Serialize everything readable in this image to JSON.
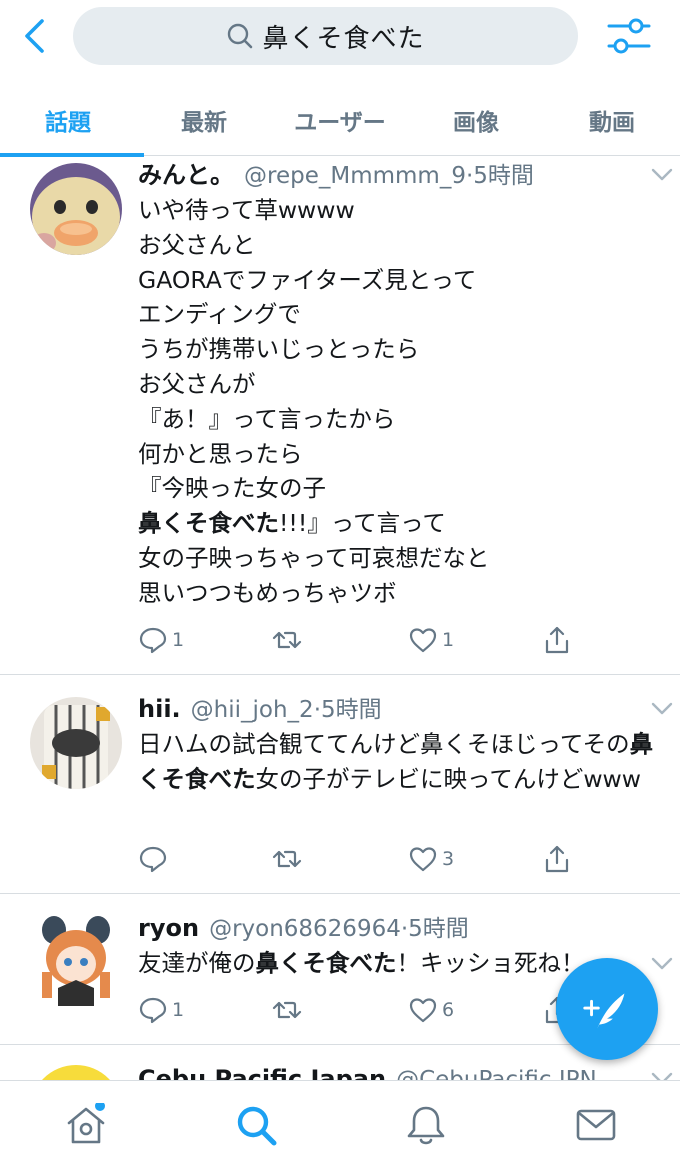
{
  "search": {
    "query": "鼻くそ食べた"
  },
  "tabs": [
    {
      "label": "話題",
      "active": true
    },
    {
      "label": "最新",
      "active": false
    },
    {
      "label": "ユーザー",
      "active": false
    },
    {
      "label": "画像",
      "active": false
    },
    {
      "label": "動画",
      "active": false
    }
  ],
  "colors": {
    "accent": "#1da1f2",
    "muted": "#657786",
    "text": "#14171a",
    "divider": "#d8dde1"
  },
  "tweets": [
    {
      "name": "みんと。",
      "handle": "@repe_Mmmmm_9",
      "time": "5時間",
      "lines": [
        "いや待って草wwww",
        "お父さんと",
        "GAORAでファイターズ見とって",
        "エンディングで",
        "うちが携帯いじっとったら",
        "お父さんが",
        "『あ！』って言ったから",
        "何かと思ったら",
        "『今映った女の子"
      ],
      "highlight": "鼻くそ食べた",
      "line_after_highlight": "!!!』って言って",
      "lines_end": [
        "女の子映っちゃって可哀想だなと",
        "思いつつもめっちゃツボ"
      ],
      "replies": "1",
      "retweets": "",
      "likes": "1"
    },
    {
      "name": "hii.",
      "handle": "@hii_joh_2",
      "time": "5時間",
      "text_before": "日ハムの試合観ててんけど鼻くそほじってその",
      "highlight": "鼻くそ食べた",
      "text_after": "女の子がテレビに映ってんけどwww",
      "replies": "",
      "retweets": "",
      "likes": "3"
    },
    {
      "name": "ryon",
      "handle": "@ryon68626964",
      "time": "5時間",
      "text_before": "友達が俺の",
      "highlight": "鼻くそ食べた",
      "text_after": "！キッショ死ね！",
      "replies": "1",
      "retweets": "",
      "likes": "6"
    },
    {
      "name": "Cebu Pacific Japan",
      "handle": "@CebuPacific JPN"
    }
  ],
  "icons": {
    "back": "chevron-left-icon",
    "search": "search-icon",
    "filter": "sliders-icon",
    "reply": "speech-bubble-icon",
    "retweet": "retweet-icon",
    "like": "heart-icon",
    "share": "share-icon",
    "compose": "feather-plus-icon",
    "nav": [
      "home-icon",
      "search-icon",
      "bell-icon",
      "mail-icon"
    ]
  }
}
